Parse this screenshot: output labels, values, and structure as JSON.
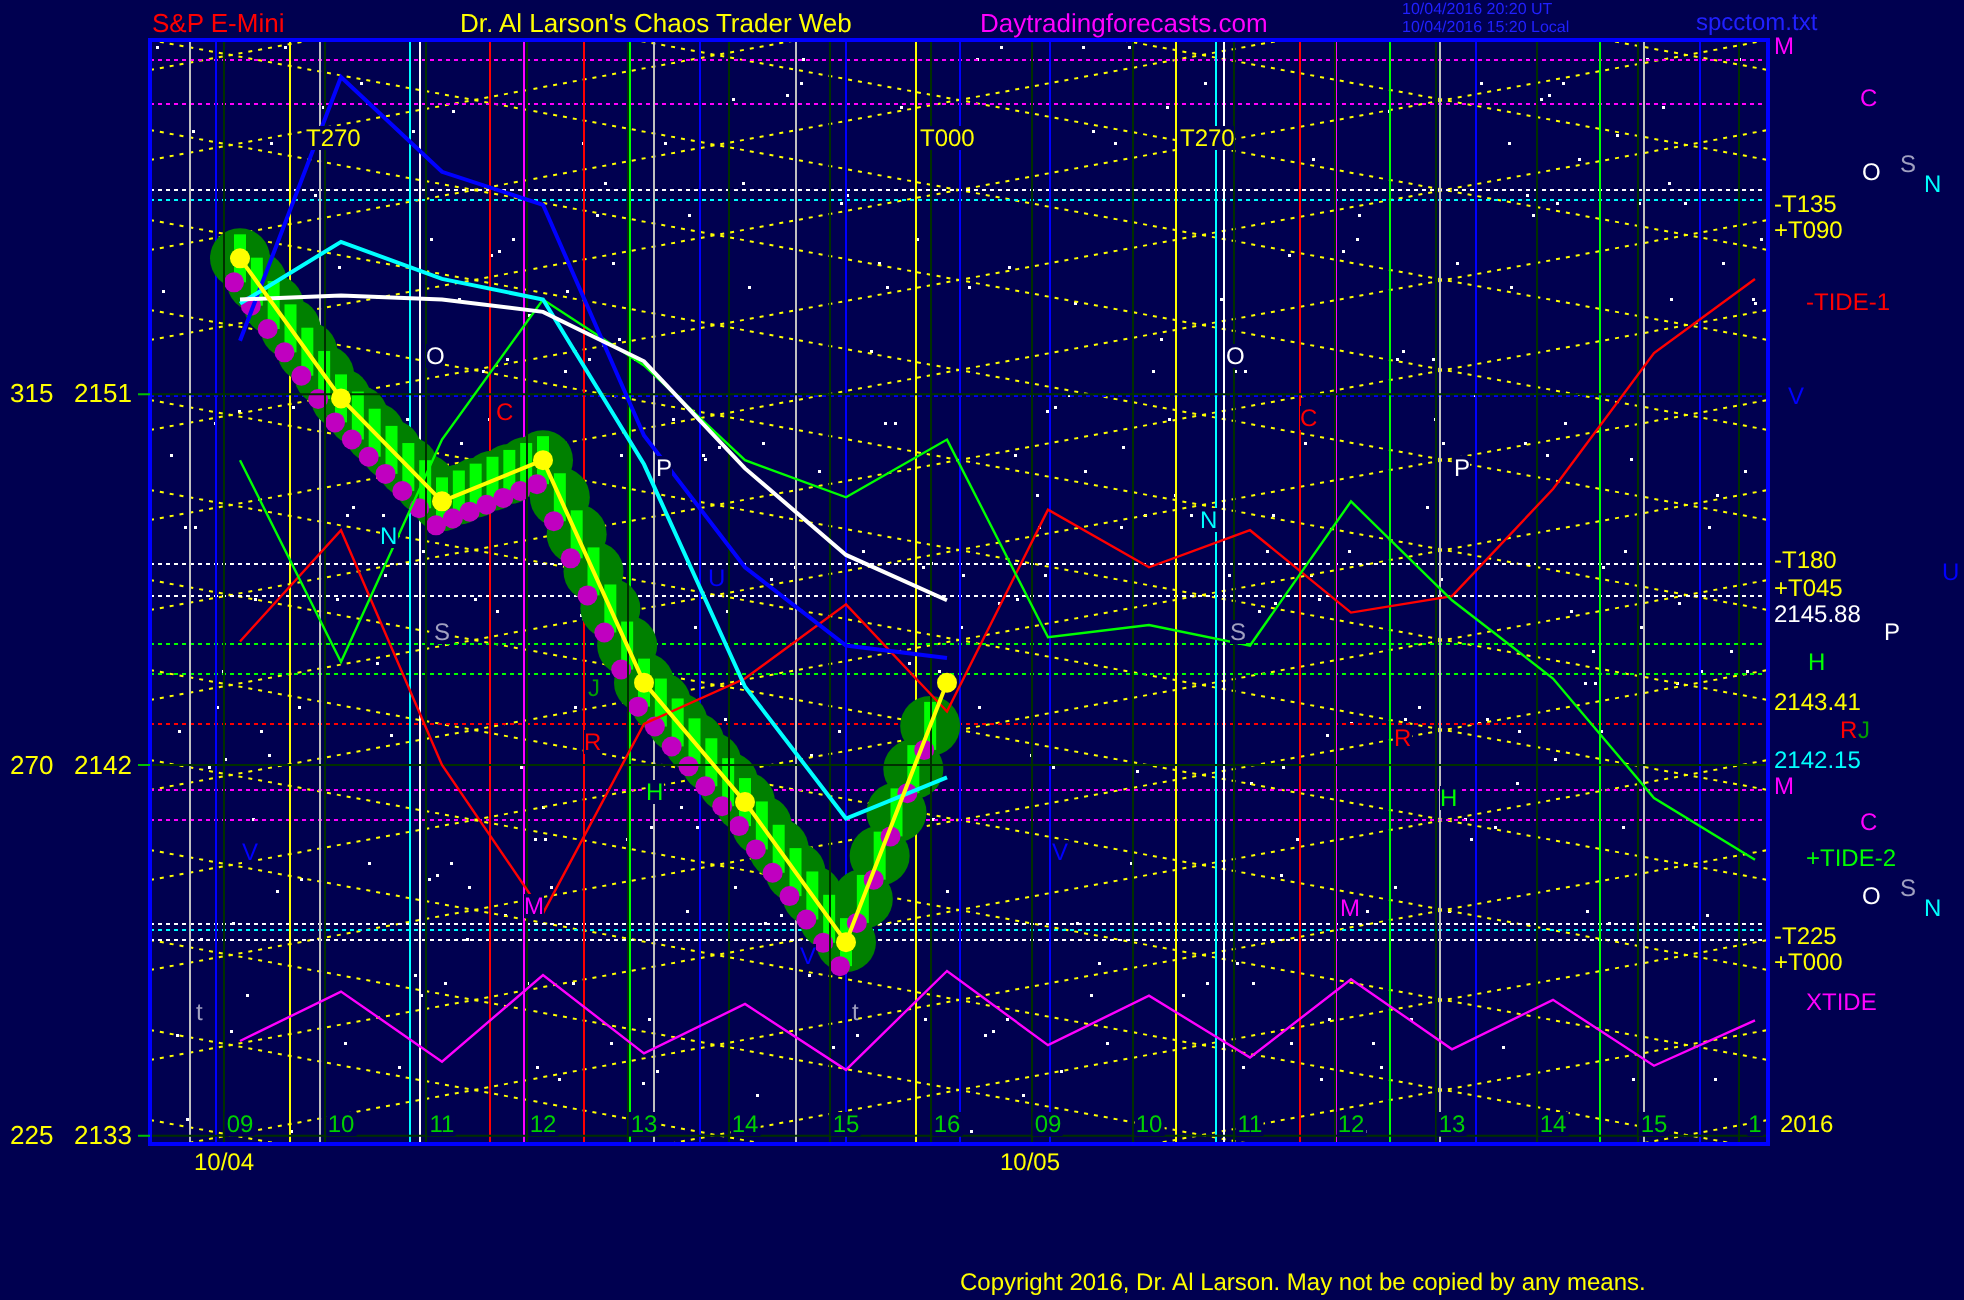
{
  "header": {
    "symbol": "S&P E-Mini",
    "title": "Dr. Al Larson's Chaos Trader Web",
    "site": "Daytradingforecasts.com",
    "timestamps": [
      "10/04/2016 20:20 UT",
      "10/04/2016 15:20 Local"
    ],
    "file": "spcctom.txt"
  },
  "chart": {
    "chart_data": {
      "type": "line",
      "grid": true,
      "marker": true,
      "categories": [
        "09",
        "10",
        "11",
        "12",
        "13",
        "14",
        "15",
        "16",
        "09",
        "10",
        "11",
        "12",
        "13",
        "14",
        "15",
        "1"
      ],
      "series": [
        {
          "color": "#ffff00",
          "values": [
            2154.3,
            2150.9,
            2148.4,
            2149.4,
            2144,
            2141.1,
            2137.7,
            2144,
            null,
            null,
            null,
            null,
            null,
            null,
            null,
            null
          ]
        },
        {
          "name": "-TIDE-1",
          "color": "#ff0000",
          "values": [
            2145.0,
            2147.7,
            2142.0,
            2138.4,
            2143.0,
            2144.1,
            2145.9,
            2143.3,
            2148.2,
            2146.8,
            2147.7,
            2145.7,
            2146.1,
            2148.7,
            2152.0,
            2153.8
          ]
        },
        {
          "name": "+TIDE-2",
          "color": "#00ff00",
          "values": [
            2149.4,
            2144.5,
            2149.9,
            2153.3,
            2151.7,
            2149.4,
            2148.5,
            2149.9,
            2145.1,
            2145.4,
            2144.9,
            2148.4,
            2146.0,
            2144.1,
            2141.2,
            2139.7
          ]
        },
        {
          "color": "#0000ff",
          "values": [
            2152.3,
            2158.7,
            2156.4,
            2155.6,
            2150.0,
            2146.8,
            2144.9,
            2144.6,
            null,
            null,
            null,
            null,
            null,
            null,
            null,
            null
          ]
        },
        {
          "color": "#00ffff",
          "values": [
            2153.2,
            2154.7,
            2153.8,
            2153.3,
            2149.3,
            2143.9,
            2140.7,
            2141.7,
            null,
            null,
            null,
            null,
            null,
            null,
            null,
            null
          ]
        },
        {
          "color": "#ffffff",
          "values": [
            2153.3,
            2153.4,
            2153.3,
            2153.0,
            2151.8,
            2149.2,
            2147.1,
            2146.0,
            null,
            null,
            null,
            null,
            null,
            null,
            null,
            null
          ]
        },
        {
          "name": "XTIDE",
          "color": "#ff00ff",
          "values": [
            2135.3,
            2136.5,
            2134.8,
            2136.9,
            2135.0,
            2136.2,
            2134.6,
            2137.0,
            2135.2,
            2136.4,
            2134.9,
            2136.8,
            2135.1,
            2136.3,
            2134.7,
            2135.8
          ]
        }
      ],
      "yticks": [
        2151,
        2142,
        2133
      ],
      "ylim": [
        2132.8,
        2159.6
      ]
    },
    "angle_labels": [
      "315",
      "270",
      "225"
    ],
    "date_labels": [
      "10/04",
      "10/05",
      "2016"
    ],
    "chart_labels": [
      {
        "text": "T270",
        "color": "#ffff00"
      },
      {
        "text": "T000",
        "color": "#ffff00"
      },
      {
        "text": "T270",
        "color": "#ffff00"
      },
      {
        "text": "O",
        "color": "#ffffff"
      },
      {
        "text": "O",
        "color": "#ffffff"
      },
      {
        "text": "P",
        "color": "#ffffff"
      },
      {
        "text": "P",
        "color": "#ffffff"
      },
      {
        "text": "C",
        "color": "#ff0000"
      },
      {
        "text": "C",
        "color": "#ff0000"
      },
      {
        "text": "N",
        "color": "#00ffff"
      },
      {
        "text": "N",
        "color": "#00ffff"
      },
      {
        "text": "S",
        "color": "#a0a0c0"
      },
      {
        "text": "S",
        "color": "#a0a0c0"
      },
      {
        "text": "U",
        "color": "#0000ff"
      },
      {
        "text": "J",
        "color": "#00a000"
      },
      {
        "text": "R",
        "color": "#ff0000"
      },
      {
        "text": "R",
        "color": "#ff0000"
      },
      {
        "text": "H",
        "color": "#00ff00"
      },
      {
        "text": "H",
        "color": "#00ff00"
      },
      {
        "text": "M",
        "color": "#ff00ff"
      },
      {
        "text": "M",
        "color": "#ff00ff"
      },
      {
        "text": "V",
        "color": "#0000ff"
      },
      {
        "text": "V",
        "color": "#0000ff"
      },
      {
        "text": "V",
        "color": "#0000ff"
      },
      {
        "text": "t",
        "color": "#a0a0c0"
      },
      {
        "text": "t",
        "color": "#a0a0c0"
      }
    ]
  },
  "right_labels": [
    {
      "text": "M",
      "color": "#ff00ff"
    },
    {
      "text": "C",
      "color": "#ff00ff"
    },
    {
      "text": "O",
      "color": "#ffffff"
    },
    {
      "text": "S",
      "color": "#a0a0c0"
    },
    {
      "text": "N",
      "color": "#00ffff"
    },
    {
      "text": "-T135",
      "color": "#ffff00"
    },
    {
      "text": "+T090",
      "color": "#ffff00"
    },
    {
      "text": "V",
      "color": "#0000ff"
    },
    {
      "text": "-T180",
      "color": "#ffff00"
    },
    {
      "text": "U",
      "color": "#0000ff"
    },
    {
      "text": "+T045",
      "color": "#ffff00"
    },
    {
      "text": "2145.88",
      "color": "#ffffff"
    },
    {
      "text": "P",
      "color": "#ffffff"
    },
    {
      "text": "H",
      "color": "#00ff00"
    },
    {
      "text": "2143.41",
      "color": "#ffff00"
    },
    {
      "text": "R",
      "color": "#ff0000"
    },
    {
      "text": "J",
      "color": "#00a000"
    },
    {
      "text": "2142.15",
      "color": "#00ffff"
    },
    {
      "text": "M",
      "color": "#ff00ff"
    },
    {
      "text": "C",
      "color": "#ff00ff"
    },
    {
      "text": "O",
      "color": "#ffffff"
    },
    {
      "text": "S",
      "color": "#a0a0c0"
    },
    {
      "text": "N",
      "color": "#00ffff"
    },
    {
      "text": "-T225",
      "color": "#ffff00"
    },
    {
      "text": "+T000",
      "color": "#ffff00"
    }
  ],
  "copyright": "Copyright 2016, Dr. Al Larson. May not be copied by any means."
}
